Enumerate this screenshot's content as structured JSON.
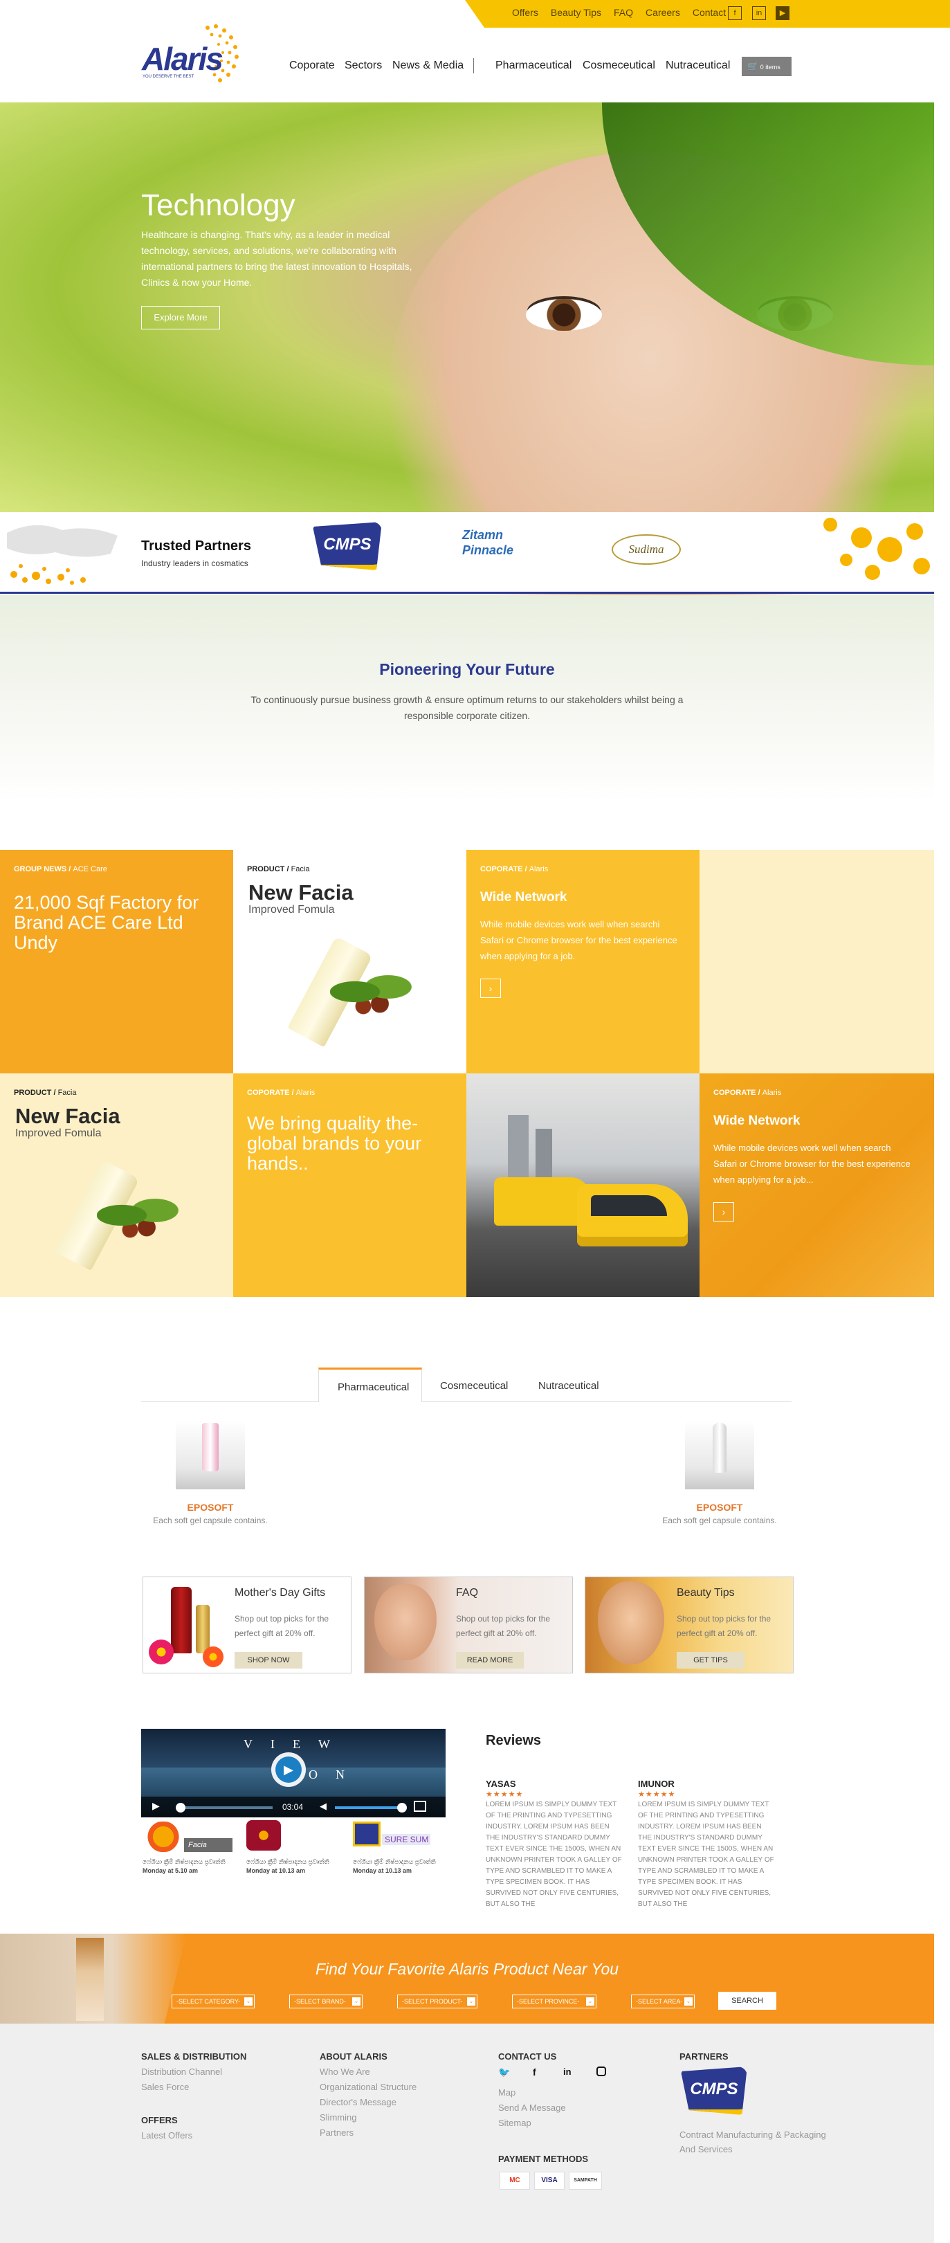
{
  "topbar": {
    "links": [
      "Offers",
      "Beauty Tips",
      "FAQ",
      "Careers",
      "Contact"
    ],
    "social": [
      "f",
      "in",
      "yt"
    ]
  },
  "logo": {
    "name": "Alaris",
    "tagline": "YOU DESERVE THE BEST"
  },
  "nav": {
    "items": [
      "Coporate",
      "Sectors",
      "News & Media",
      "Pharmaceutical",
      "Cosmeceutical",
      "Nutraceutical"
    ],
    "cart": "0 items"
  },
  "hero": {
    "title": "Technology",
    "text": "Healthcare is changing. That's why, as a leader in medical technology, services, and solutions, we're collaborating with international partners to bring the latest innovation to Hospitals, Clinics & now your Home.",
    "button": "Explore More"
  },
  "partners": {
    "title": "Trusted Partners",
    "subtitle": "Industry leaders in cosmatics",
    "logos": [
      "CMPS",
      "Zitamn Pinnacle",
      "Sudima"
    ]
  },
  "pioneer": {
    "title": "Pioneering Your Future",
    "text": "To continuously pursue business growth & ensure optimum returns to our stakeholders whilst being a responsible corporate citizen."
  },
  "tiles": {
    "t1": {
      "cat": "GROUP NEWS",
      "sub": "ACE Care",
      "title": "21,000 Sqf Factory for Brand ACE Care Ltd Undy"
    },
    "t2": {
      "cat": "PRODUCT",
      "sub": "Facia",
      "title": "New Facia",
      "subtitle": "Improved Fomula"
    },
    "t3": {
      "cat": "COPORATE",
      "sub": "Alaris",
      "title": "Wide Network",
      "text": "While mobile devices work well when searchi Safari or Chrome browser for the best experience when applying for a job."
    },
    "t5": {
      "cat": "PRODUCT",
      "sub": "Facia",
      "title": "New Facia",
      "subtitle": "Improved Fomula"
    },
    "t6": {
      "cat": "COPORATE",
      "sub": "Alaris",
      "title": "We bring quality the-global brands to your hands.."
    },
    "t8": {
      "cat": "COPORATE",
      "sub": "Alaris",
      "title": "Wide Network",
      "text": "While mobile devices work well when search Safari or Chrome browser for the best experience when applying for a job..."
    },
    "arrow": "›"
  },
  "tabs": [
    "Pharmaceutical",
    "Cosmeceutical",
    "Nutraceutical"
  ],
  "products": [
    {
      "name": "EPOSOFT",
      "desc": "Each soft gel capsule contains."
    },
    {
      "name": "EPOSOFT",
      "desc": "Each soft gel capsule contains."
    }
  ],
  "promos": [
    {
      "title": "Mother's Day Gifts",
      "text": "Shop out top picks for the perfect gift at 20% off.",
      "button": "SHOP NOW"
    },
    {
      "title": "FAQ",
      "text": "Shop out top picks for the perfect gift at 20% off.",
      "button": "READ MORE"
    },
    {
      "title": "Beauty Tips",
      "text": "Shop out top picks for the perfect gift at 20% off.",
      "button": "GET TIPS"
    }
  ],
  "video": {
    "line1": "VIEW",
    "line2": "MON",
    "time": "03:04",
    "news": [
      {
        "channel": "Facia",
        "caption": "ෆේශියා ක්‍රීම් නිෂ්පාදනය ප්‍රවෘත්ති",
        "time": "Monday at 5.10 am"
      },
      {
        "channel": "",
        "caption": "ෆේශියා ක්‍රීම් නිෂ්පාදනය ප්‍රවෘත්ති",
        "time": "Monday at 10.13 am"
      },
      {
        "channel": "SURE SUM",
        "caption": "ෆේශියා ක්‍රීම් නිෂ්පාදනය ප්‍රවෘත්ති",
        "time": "Monday at 10.13 am"
      }
    ]
  },
  "reviews": {
    "title": "Reviews",
    "items": [
      {
        "name": "YASAS",
        "stars": "★★★★★",
        "text": "LOREM IPSUM IS SIMPLY DUMMY TEXT OF THE PRINTING AND TYPESETTING INDUSTRY. LOREM IPSUM HAS BEEN THE INDUSTRY'S STANDARD DUMMY TEXT EVER SINCE THE 1500S, WHEN AN UNKNOWN PRINTER TOOK A GALLEY OF TYPE AND SCRAMBLED IT TO MAKE A TYPE SPECIMEN BOOK. IT HAS SURVIVED NOT ONLY FIVE CENTURIES, BUT ALSO THE"
      },
      {
        "name": "IMUNOR",
        "stars": "★★★★★",
        "text": "LOREM IPSUM IS SIMPLY DUMMY TEXT OF THE PRINTING AND TYPESETTING INDUSTRY. LOREM IPSUM HAS BEEN THE INDUSTRY'S STANDARD DUMMY TEXT EVER SINCE THE 1500S, WHEN AN UNKNOWN PRINTER TOOK A GALLEY OF TYPE AND SCRAMBLED IT TO MAKE A TYPE SPECIMEN BOOK. IT HAS SURVIVED NOT ONLY FIVE CENTURIES, BUT ALSO THE"
      }
    ]
  },
  "find": {
    "title": "Find Your Favorite Alaris Product Near You",
    "selects": [
      "-SELECT CATEGORY-",
      "-SELECT BRAND-",
      "-SELECT PRODUCT-",
      "-SELECT PROVINCE-",
      "-SELECT AREA-"
    ],
    "button": "SEARCH"
  },
  "footer": {
    "sales": {
      "title": "SALES & DISTRIBUTION",
      "links": [
        "Distribution Channel",
        "Sales Force"
      ]
    },
    "offers": {
      "title": "OFFERS",
      "links": [
        "Latest Offers"
      ]
    },
    "about": {
      "title": "ABOUT ALARIS",
      "links": [
        "Who We Are",
        "Organizational Structure",
        "Director's Message",
        "Slimming",
        "Partners"
      ]
    },
    "contact": {
      "title": "CONTACT US",
      "links": [
        "Map",
        "Send A Message",
        "Sitemap"
      ]
    },
    "payment": {
      "title": "PAYMENT METHODS",
      "methods": [
        "MC",
        "VISA",
        "SAMPATH"
      ]
    },
    "partners": {
      "title": "PARTNERS",
      "logo": "CMPS",
      "text": "Contract Manufacturing & Packaging And Services"
    }
  }
}
